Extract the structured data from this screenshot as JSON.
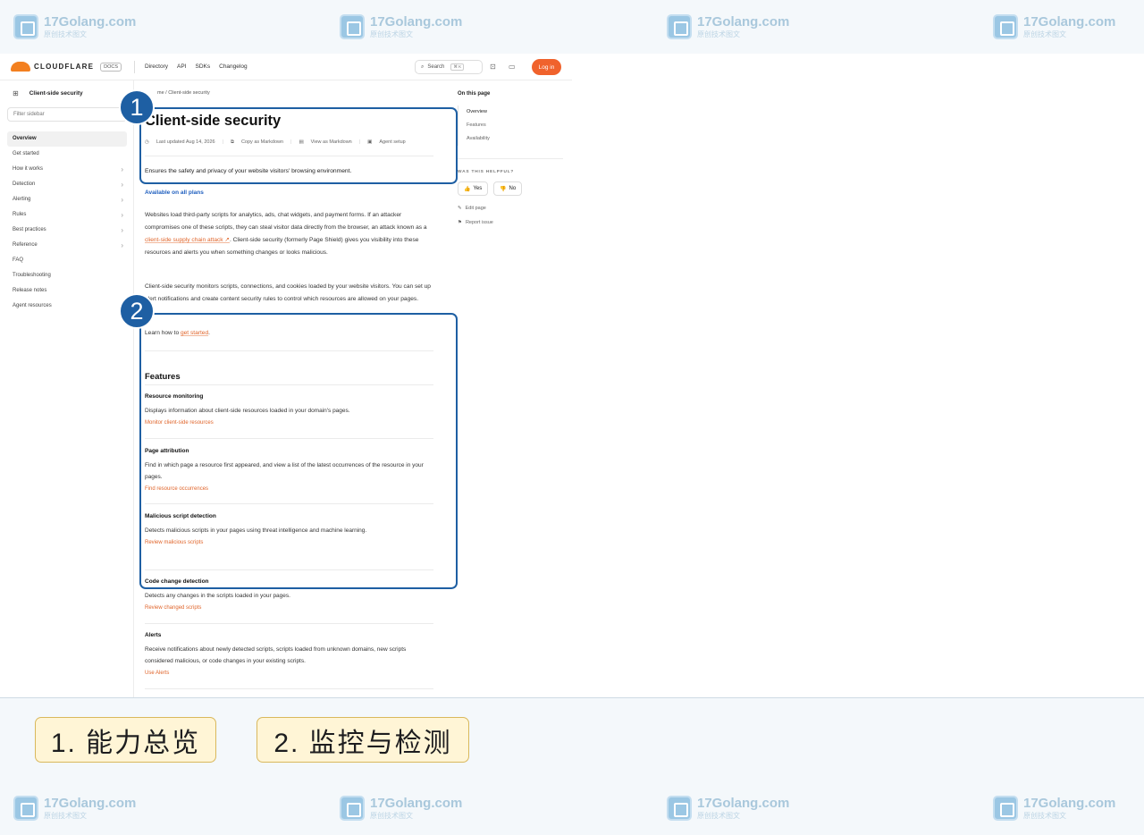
{
  "watermark": {
    "name": "17Golang.com",
    "sub": "原创技术图文"
  },
  "topbar": {
    "brand": "CLOUDFLARE",
    "badge": "DOCS",
    "nav": [
      "Directory",
      "API",
      "SDKs",
      "Changelog"
    ],
    "search_label": "Search",
    "shortcut": "⌘ K",
    "login_label": "Log in"
  },
  "sidebar": {
    "title": "Client-side security",
    "filter_placeholder": "Filter sidebar",
    "items": [
      {
        "label": "Overview",
        "active": true
      },
      {
        "label": "Get started"
      },
      {
        "label": "How it works",
        "chevron": true
      },
      {
        "label": "Detection",
        "chevron": true
      },
      {
        "label": "Alerting",
        "chevron": true
      },
      {
        "label": "Rules",
        "chevron": true
      },
      {
        "label": "Best practices",
        "chevron": true
      },
      {
        "label": "Reference",
        "chevron": true
      },
      {
        "label": "FAQ"
      },
      {
        "label": "Troubleshooting"
      },
      {
        "label": "Release notes"
      },
      {
        "label": "Agent resources"
      }
    ]
  },
  "main": {
    "breadcrumb_home": "me",
    "breadcrumb_sep": "/",
    "breadcrumb_current": "Client-side security",
    "title": "Client-side security",
    "meta": {
      "updated": "Last updated Aug 14, 2026",
      "copy": "Copy as Markdown",
      "view": "View as Markdown",
      "agent": "Agent setup"
    },
    "lead": "Ensures the safety and privacy of your website visitors' browsing environment.",
    "plans": "Available on all plans",
    "para1_a": "Websites load third-party scripts for analytics, ads, chat widgets, and payment forms. If an attacker compromises one of these scripts, they can steal visitor data directly from the browser, an attack known as a ",
    "para1_link": "client-side supply chain attack ↗",
    "para1_b": ". Client-side security (formerly Page Shield) gives you visibility into these resources and alerts you when something changes or looks malicious.",
    "para2": "Client-side security monitors scripts, connections, and cookies loaded by your website visitors. You can set up alert notifications and create content security rules to control which resources are allowed on your pages.",
    "learn_a": "Learn how to ",
    "learn_link": "get started",
    "learn_b": ".",
    "features_heading": "Features",
    "features": [
      {
        "title": "Resource monitoring",
        "desc": "Displays information about client-side resources loaded in your domain's pages.",
        "link": "Monitor client-side resources"
      },
      {
        "title": "Page attribution",
        "desc": "Find in which page a resource first appeared, and view a list of the latest occurrences of the resource in your pages.",
        "link": "Find resource occurrences"
      },
      {
        "title": "Malicious script detection",
        "desc": "Detects malicious scripts in your pages using threat intelligence and machine learning.",
        "link": "Review malicious scripts"
      },
      {
        "title": "Code change detection",
        "desc": "Detects any changes in the scripts loaded in your pages.",
        "link": "Review changed scripts"
      },
      {
        "title": "Alerts",
        "desc": "Receive notifications about newly detected scripts, scripts loaded from unknown domains, new scripts considered malicious, or code changes in your existing scripts.",
        "link": "Use Alerts"
      }
    ]
  },
  "onpage": {
    "heading": "On this page",
    "items": [
      "Overview",
      "Features",
      "Availability"
    ],
    "helpful": "WAS THIS HELPFUL?",
    "yes": "Yes",
    "no": "No",
    "edit": "Edit page",
    "report": "Report issue"
  },
  "annotations": {
    "badge1": "1",
    "badge2": "2",
    "label1": "1. 能力总览",
    "label2": "2. 监控与检测",
    "color": "#1e5fa3"
  }
}
